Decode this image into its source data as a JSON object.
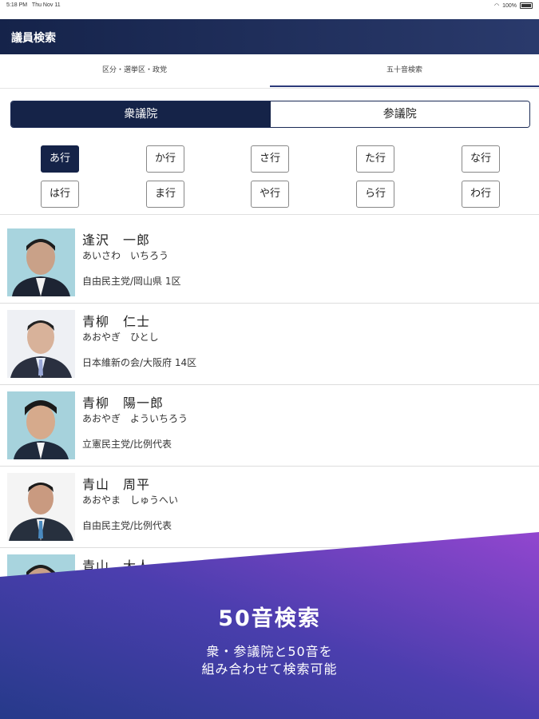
{
  "status_bar": {
    "time": "5:18 PM",
    "date": "Thu Nov 11",
    "battery": "100%"
  },
  "app_bar": {
    "title": "議員検索"
  },
  "tabs": [
    {
      "label": "区分・選挙区・政党",
      "active": false
    },
    {
      "label": "五十音検索",
      "active": true
    }
  ],
  "chamber_toggle": [
    {
      "label": "衆議院",
      "active": true
    },
    {
      "label": "参議院",
      "active": false
    }
  ],
  "kana_rows": [
    [
      "あ行",
      "か行",
      "さ行",
      "た行",
      "な行"
    ],
    [
      "は行",
      "ま行",
      "や行",
      "ら行",
      "わ行"
    ]
  ],
  "selected_kana": "あ行",
  "members": [
    {
      "name": "逢沢　一郎",
      "reading": "あいさわ　いちろう",
      "party": "自由民主党/岡山県 1区"
    },
    {
      "name": "青柳　仁士",
      "reading": "あおやぎ　ひとし",
      "party": "日本維新の会/大阪府 14区"
    },
    {
      "name": "青柳　陽一郎",
      "reading": "あおやぎ　よういちろう",
      "party": "立憲民主党/比例代表"
    },
    {
      "name": "青山　周平",
      "reading": "あおやま　しゅうへい",
      "party": "自由民主党/比例代表"
    },
    {
      "name": "青山　大人",
      "reading": "",
      "party": ""
    }
  ],
  "promo": {
    "title": "50音検索",
    "subtitle_line1": "衆・参議院と50音を",
    "subtitle_line2": "組み合わせて検索可能"
  },
  "colors": {
    "app_bar": "#15234a",
    "accent": "#2c3a7a",
    "promo_start": "#283a8c",
    "promo_end": "#8a45cf"
  }
}
